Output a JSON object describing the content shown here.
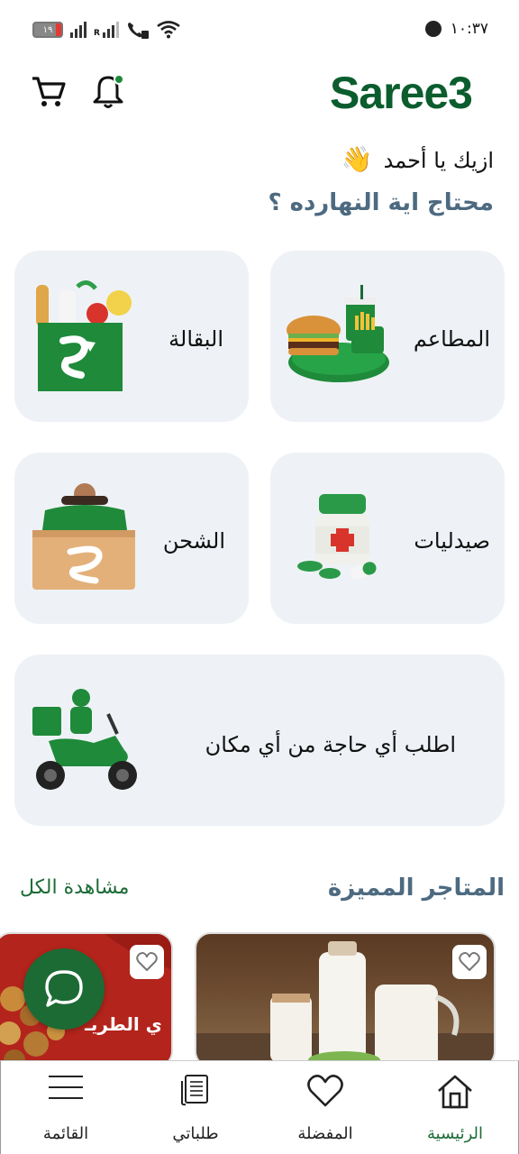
{
  "status_bar": {
    "time": "١٠:٣٧",
    "battery": "١٩",
    "network_label": "R"
  },
  "header": {
    "logo_text": "Saree3",
    "notification_dot_color": "#1b8a3c"
  },
  "greeting": {
    "text": "ازيك يا أحمد",
    "emoji": "👋",
    "question": "محتاج اية النهارده ؟"
  },
  "categories": [
    {
      "id": "restaurants",
      "label": "المطاعم",
      "icon": "burger-meal-icon"
    },
    {
      "id": "grocery",
      "label": "البقالة",
      "icon": "grocery-bag-icon"
    },
    {
      "id": "pharmacies",
      "label": "صيدليات",
      "icon": "medicine-bottle-icon"
    },
    {
      "id": "shipping",
      "label": "الشحن",
      "icon": "courier-box-icon"
    },
    {
      "id": "anything",
      "label": "اطلب أي حاجة من أي مكان",
      "icon": "delivery-scooter-icon"
    }
  ],
  "featured": {
    "title": "المتاجر المميزة",
    "see_all": "مشاهدة الكل",
    "store_2_text": "ي الطريـ"
  },
  "bottom_nav": [
    {
      "id": "home",
      "label": "الرئيسية",
      "active": true
    },
    {
      "id": "favorites",
      "label": "المفضلة",
      "active": false
    },
    {
      "id": "orders",
      "label": "طلباتي",
      "active": false
    },
    {
      "id": "menu",
      "label": "القائمة",
      "active": false
    }
  ],
  "colors": {
    "brand": "#0b5d2e",
    "accent": "#1b6b36",
    "card_bg": "#eef2f6",
    "question": "#4d6a80"
  }
}
